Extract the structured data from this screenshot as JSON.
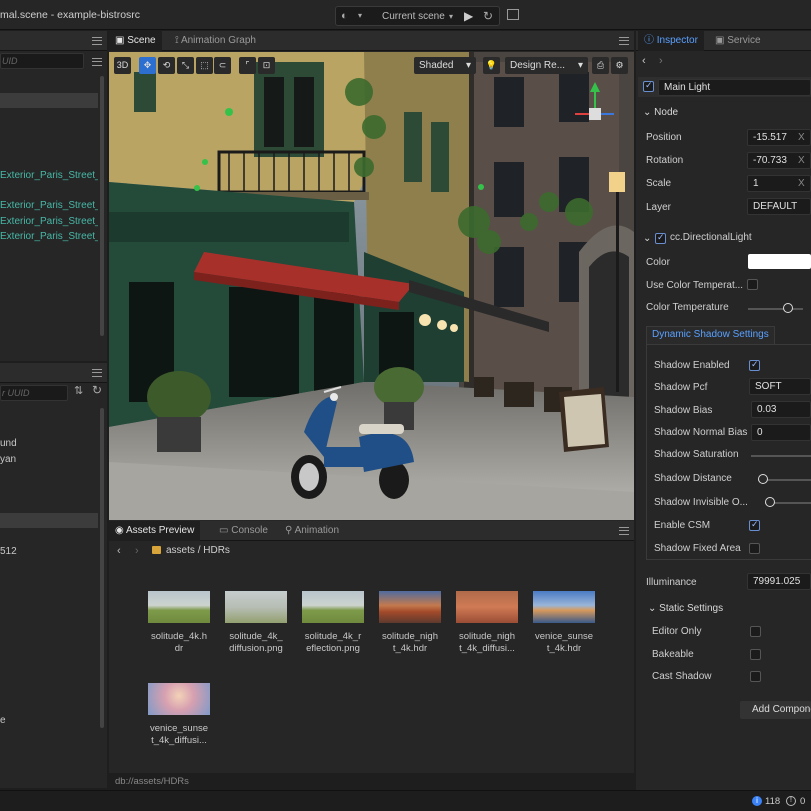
{
  "window": {
    "title": "mal.scene - example-bistrosrc"
  },
  "toolbar": {
    "scene_select": "Current scene"
  },
  "hierarchy": {
    "search_placeholder": "UID",
    "items": [
      {
        "label": ""
      },
      {
        "label": "Exterior_Paris_Street_"
      },
      {
        "label": "Exterior_Paris_Street_("
      },
      {
        "label": "Exterior_Paris_Street_("
      },
      {
        "label": "Exterior_Paris_Street_("
      }
    ]
  },
  "assets_tree": {
    "search_placeholder": "r UUID",
    "items": [
      {
        "label": "und"
      },
      {
        "label": "yan"
      },
      {
        "label": ""
      },
      {
        "label": "512"
      },
      {
        "label": "e"
      }
    ]
  },
  "scene_panel": {
    "tabs": [
      {
        "label": "Scene"
      },
      {
        "label": "Animation Graph"
      }
    ],
    "mode_3d": "3D",
    "shading_select": "Shaded",
    "resolution_select": "Design Re..."
  },
  "assets_panel": {
    "tabs": [
      {
        "label": "Assets Preview"
      },
      {
        "label": "Console"
      },
      {
        "label": "Animation"
      }
    ],
    "breadcrumb": {
      "root": "assets",
      "sep": "/",
      "current": "HDRs"
    },
    "path_footer": "db://assets/HDRs",
    "items": [
      {
        "name": "solitude_4k.hdr",
        "line1": "solitude_4k.h",
        "line2": "dr",
        "icon": "hdr-meadow"
      },
      {
        "name": "solitude_4k_diffusion.png",
        "line1": "solitude_4k_",
        "line2": "diffusion.png",
        "icon": "hdr-meadow-blur"
      },
      {
        "name": "solitude_4k_reflection.png",
        "line1": "solitude_4k_r",
        "line2": "eflection.png",
        "icon": "hdr-meadow"
      },
      {
        "name": "solitude_night_4k.hdr",
        "line1": "solitude_nigh",
        "line2": "t_4k.hdr",
        "icon": "hdr-sunset-orange"
      },
      {
        "name": "solitude_night_4k_diffusion",
        "line1": "solitude_nigh",
        "line2": "t_4k_diffusi...",
        "icon": "hdr-sunset-blur"
      },
      {
        "name": "venice_sunset_4k.hdr",
        "line1": "venice_sunse",
        "line2": "t_4k.hdr",
        "icon": "hdr-venice"
      },
      {
        "name": "venice_sunset_4k_diffusion",
        "line1": "venice_sunse",
        "line2": "t_4k_diffusi...",
        "icon": "hdr-venice-blur"
      }
    ]
  },
  "inspector": {
    "tabs": [
      {
        "label": "Inspector"
      },
      {
        "label": "Service"
      }
    ],
    "node_name": "Main Light",
    "node_section": "Node",
    "position": {
      "label": "Position",
      "x": "-15.517",
      "axis": "X"
    },
    "rotation": {
      "label": "Rotation",
      "x": "-70.733",
      "axis": "X"
    },
    "scale": {
      "label": "Scale",
      "x": "1",
      "axis": "X"
    },
    "layer": {
      "label": "Layer",
      "value": "DEFAULT"
    },
    "component": "cc.DirectionalLight",
    "color": {
      "label": "Color",
      "value": "#ffffff"
    },
    "use_color_temperature": "Use Color Temperat...",
    "color_temperature": {
      "label": "Color Temperature",
      "level": 0.78
    },
    "dynamic_shadow_tab": "Dynamic Shadow Settings",
    "shadow_enabled": "Shadow Enabled",
    "shadow_pcf": {
      "label": "Shadow Pcf",
      "value": "SOFT"
    },
    "shadow_bias": {
      "label": "Shadow Bias",
      "value": "0.03"
    },
    "shadow_normal_bias": {
      "label": "Shadow Normal Bias",
      "value": "0"
    },
    "shadow_saturation": "Shadow Saturation",
    "shadow_distance": {
      "label": "Shadow Distance",
      "level": 0.0
    },
    "shadow_invisible": {
      "label": "Shadow Invisible O...",
      "level": 0.0
    },
    "enable_csm": "Enable CSM",
    "shadow_fixed_area": "Shadow Fixed Area",
    "illuminance": {
      "label": "Illuminance",
      "value": "79991.025"
    },
    "static_settings": "Static Settings",
    "editor_only": "Editor Only",
    "bakeable": "Bakeable",
    "cast_shadow": "Cast Shadow",
    "add_component": "Add Compone"
  },
  "status": {
    "info_count": "118",
    "warn_count": "0"
  },
  "colors": {
    "accent": "#2d6fd0",
    "prefab_text": "#47b8a7",
    "awning": "#a8302a",
    "scooter": "#1f4f86"
  }
}
